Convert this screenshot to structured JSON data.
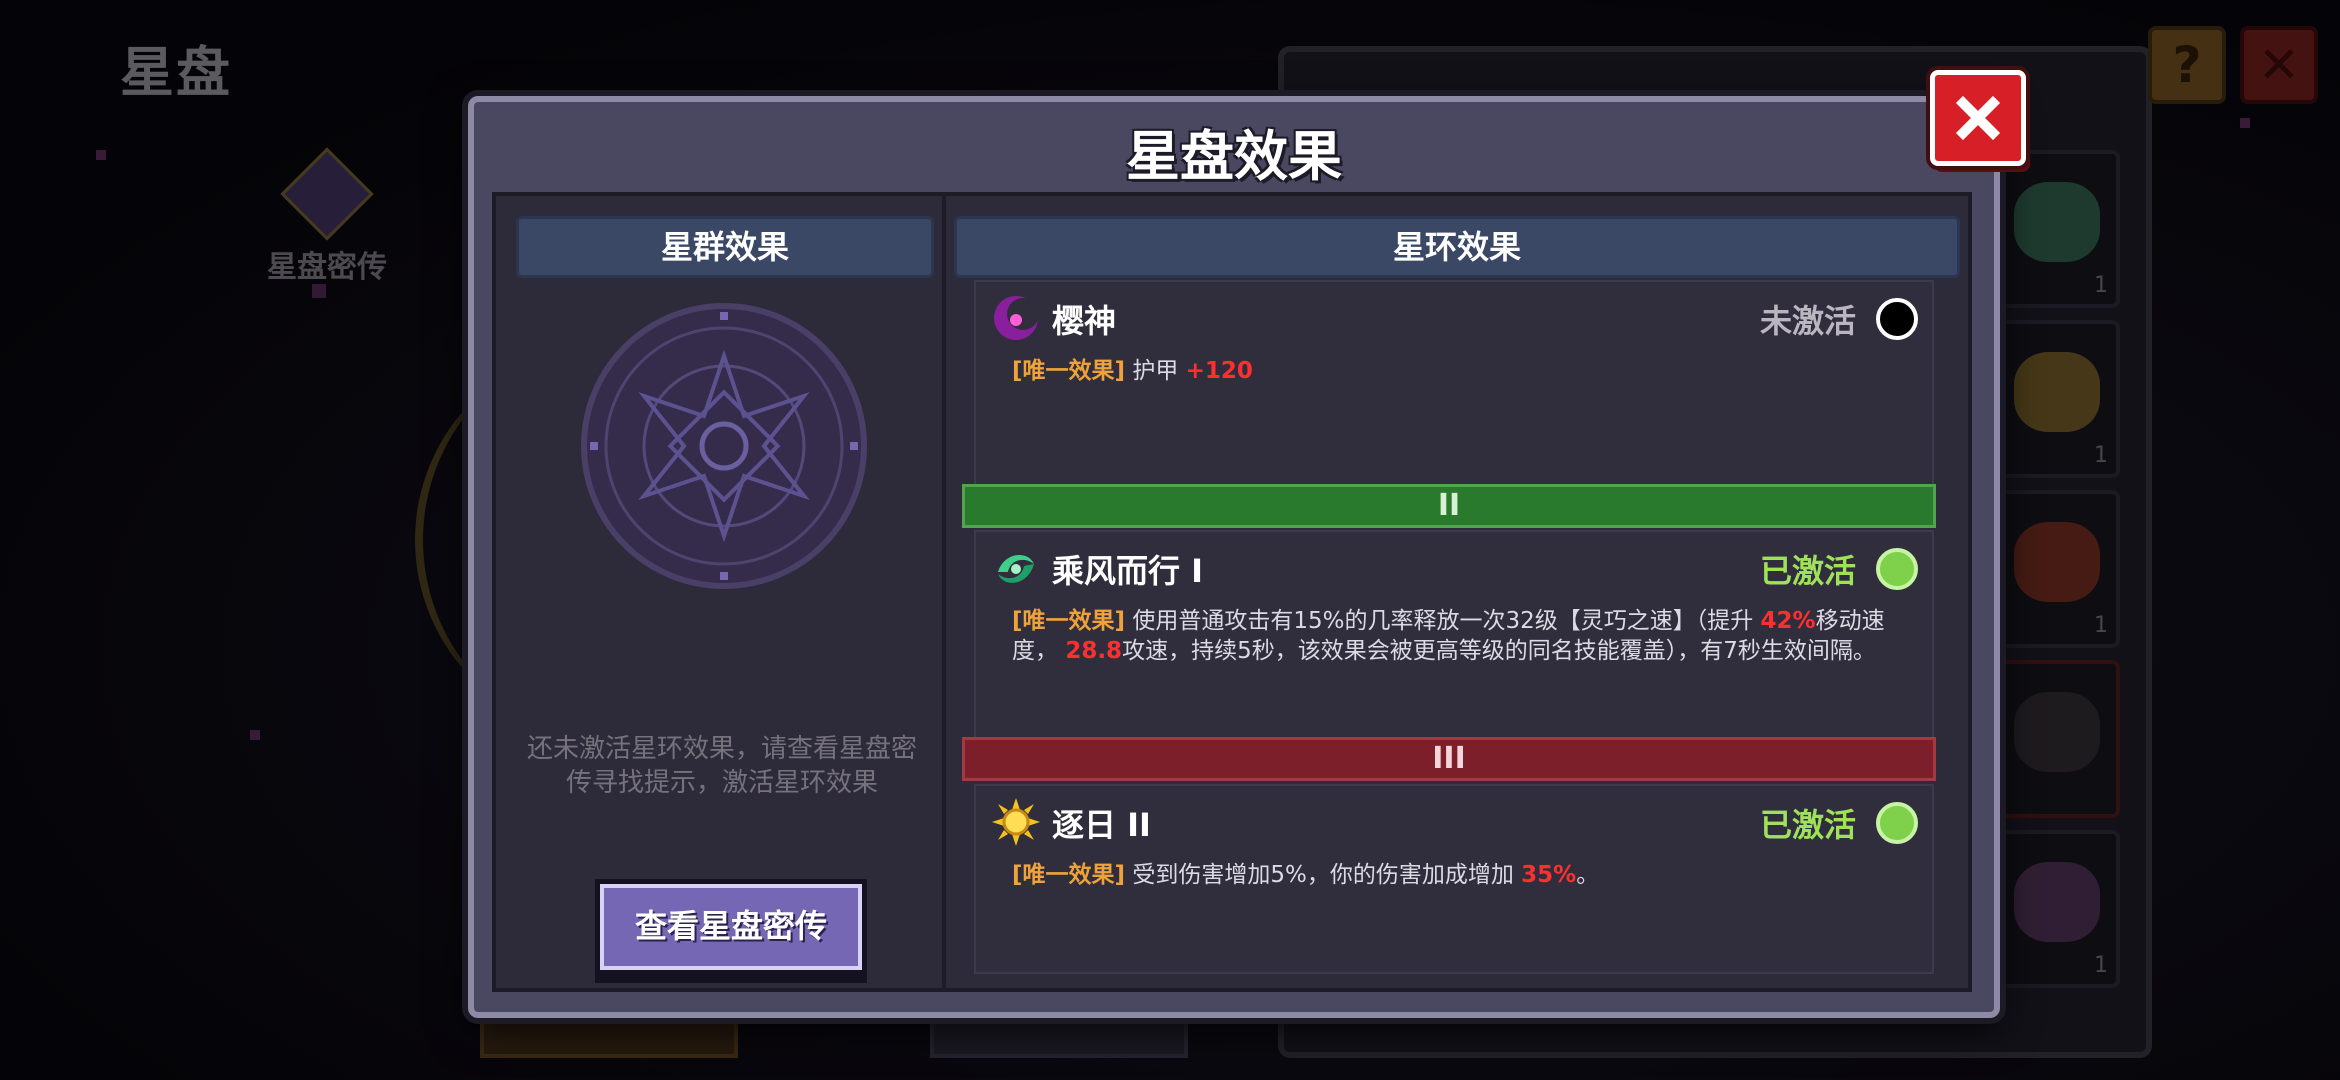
{
  "background": {
    "page_title": "星盘",
    "side_item_label": "星盘密传",
    "help_icon": "question-icon",
    "close_icon": "close-icon",
    "slot_counts": [
      "1",
      "1",
      "1",
      "1"
    ]
  },
  "modal": {
    "title": "星盘效果",
    "close_icon": "close-icon",
    "left": {
      "header": "星群效果",
      "hint": "还未激活星环效果，请查看星盘密传寻找提示，激活星环效果",
      "button_label": "查看星盘密传"
    },
    "right": {
      "header": "星环效果",
      "tiers": [
        {
          "label": "",
          "effect": {
            "name": "樱神",
            "status": "未激活",
            "status_color": "#b9b6c0",
            "dot_color": "#000000",
            "icon": "pink-crescent-icon",
            "tag": "[唯一效果]",
            "text_parts": [
              "护甲 ",
              "+120",
              ""
            ]
          }
        },
        {
          "label": "II",
          "color": "#2a7a2e",
          "effect": {
            "name": "乘风而行 I",
            "status": "已激活",
            "status_color": "#9fe25a",
            "dot_color": "#7fd04a",
            "icon": "green-wind-icon",
            "tag": "[唯一效果]",
            "text_parts": [
              "使用普通攻击有15%的几率释放一次32级【灵巧之速】（提升 ",
              "42%",
              "移动速度， ",
              "28.8",
              "攻速，持续5秒，该效果会被更高等级的同名技能覆盖），有7秒生效间隔。"
            ]
          }
        },
        {
          "label": "III",
          "color": "#7d1f2b",
          "effect": {
            "name": "逐日 II",
            "status": "已激活",
            "status_color": "#9fe25a",
            "dot_color": "#7fd04a",
            "icon": "sun-icon",
            "tag": "[唯一效果]",
            "text_parts": [
              "受到伤害增加5%，你的伤害加成增加 ",
              "35%",
              "。"
            ]
          }
        }
      ]
    }
  }
}
